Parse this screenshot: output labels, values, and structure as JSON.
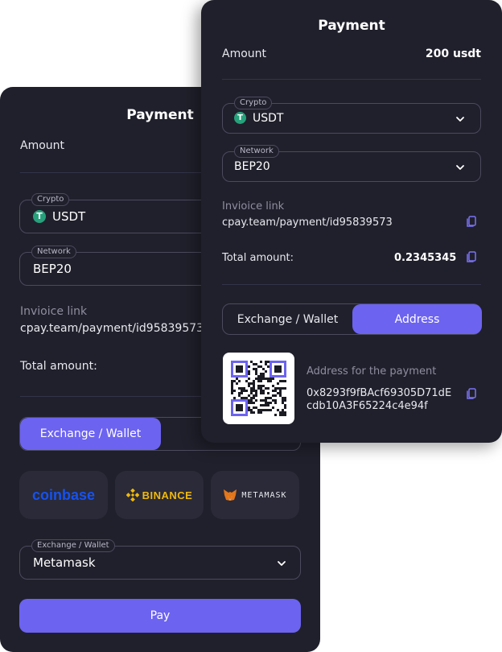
{
  "back": {
    "title": "Payment",
    "amount_label": "Amount",
    "crypto": {
      "legend": "Crypto",
      "value": "USDT",
      "icon": "tether-icon"
    },
    "network": {
      "legend": "Network",
      "value": "BEP20"
    },
    "invoice_label": "Invioice link",
    "invoice_link": "cpay.team/payment/id95839573",
    "total_label": "Total amount:",
    "tabs": {
      "active": "Exchange / Wallet"
    },
    "brands": [
      "coinbase",
      "BINANCE",
      "METAMASK"
    ],
    "wallet": {
      "legend": "Exchange / Wallet",
      "value": "Metamask"
    },
    "pay_label": "Pay"
  },
  "front": {
    "title": "Payment",
    "amount_label": "Amount",
    "amount_value": "200 usdt",
    "crypto": {
      "legend": "Crypto",
      "value": "USDT",
      "icon": "tether-icon"
    },
    "network": {
      "legend": "Network",
      "value": "BEP20"
    },
    "invoice_label": "Invioice link",
    "invoice_link": "cpay.team/payment/id95839573",
    "total_label": "Total amount:",
    "total_value": "0.2345345",
    "tabs": {
      "left": "Exchange / Wallet",
      "right": "Address",
      "active": "Address"
    },
    "address_label": "Address for the payment",
    "address_line1": "0x8293f9fBAcf69305D71dE",
    "address_line2": "cdb10A3F65224c4e94f"
  },
  "colors": {
    "background": "#20202c",
    "accent": "#6c63f0",
    "tether": "#26a17b",
    "binance": "#f0b90b",
    "coinbase": "#1652f0",
    "metamask": "#e2761b"
  }
}
